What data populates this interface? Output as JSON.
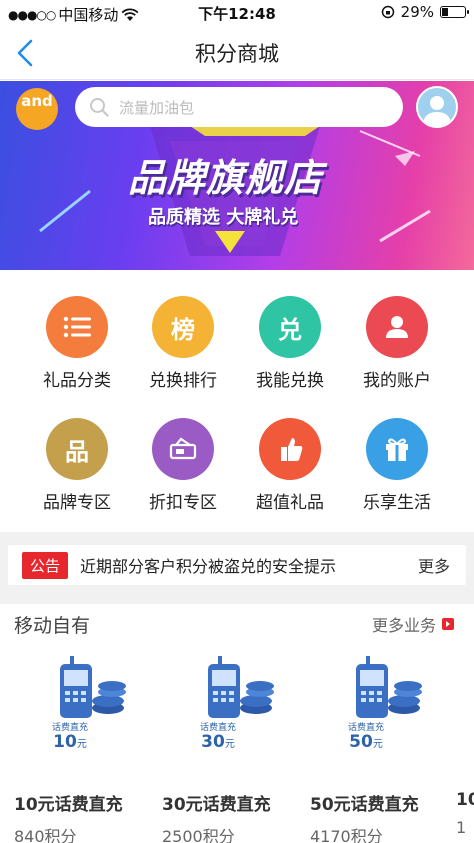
{
  "status_bar": {
    "carrier": "中国移动",
    "time": "下午12:48",
    "battery": "29%",
    "battery_level": 0.29
  },
  "nav": {
    "title": "积分商城"
  },
  "banner": {
    "logo_text": "and",
    "search_placeholder": "流量加油包",
    "headline": "品牌旗舰店",
    "subline": "品质精选 大牌礼兑"
  },
  "grid": [
    {
      "label": "礼品分类",
      "color": "#f47c3c",
      "icon": "list-icon"
    },
    {
      "label": "兑换排行",
      "color": "#f5b335",
      "icon": "ranking-icon",
      "glyph": "榜"
    },
    {
      "label": "我能兑换",
      "color": "#2fc4a4",
      "icon": "exchange-icon",
      "glyph": "兑"
    },
    {
      "label": "我的账户",
      "color": "#ec4a53",
      "icon": "user-icon"
    },
    {
      "label": "品牌专区",
      "color": "#c4a04c",
      "icon": "brand-icon",
      "glyph": "品"
    },
    {
      "label": "折扣专区",
      "color": "#9a5cc4",
      "icon": "ticket-icon"
    },
    {
      "label": "超值礼品",
      "color": "#f05a3a",
      "icon": "thumbs-up-icon"
    },
    {
      "label": "乐享生活",
      "color": "#3aa0e6",
      "icon": "gift-icon"
    }
  ],
  "notice": {
    "tag": "公告",
    "message": "近期部分客户积分被盗兑的安全提示",
    "more": "更多"
  },
  "section": {
    "title": "移动自有",
    "more": "更多业务"
  },
  "products": [
    {
      "caption": "话费直充",
      "amount": "10",
      "unit": "元",
      "name": "10元话费直充",
      "points": "840积分"
    },
    {
      "caption": "话费直充",
      "amount": "30",
      "unit": "元",
      "name": "30元话费直充",
      "points": "2500积分"
    },
    {
      "caption": "话费直充",
      "amount": "50",
      "unit": "元",
      "name": "50元话费直充",
      "points": "4170积分"
    },
    {
      "name": "10",
      "points": "1"
    }
  ],
  "colors": {
    "accent_blue": "#1f8ce8",
    "notice_red": "#e6282e"
  }
}
